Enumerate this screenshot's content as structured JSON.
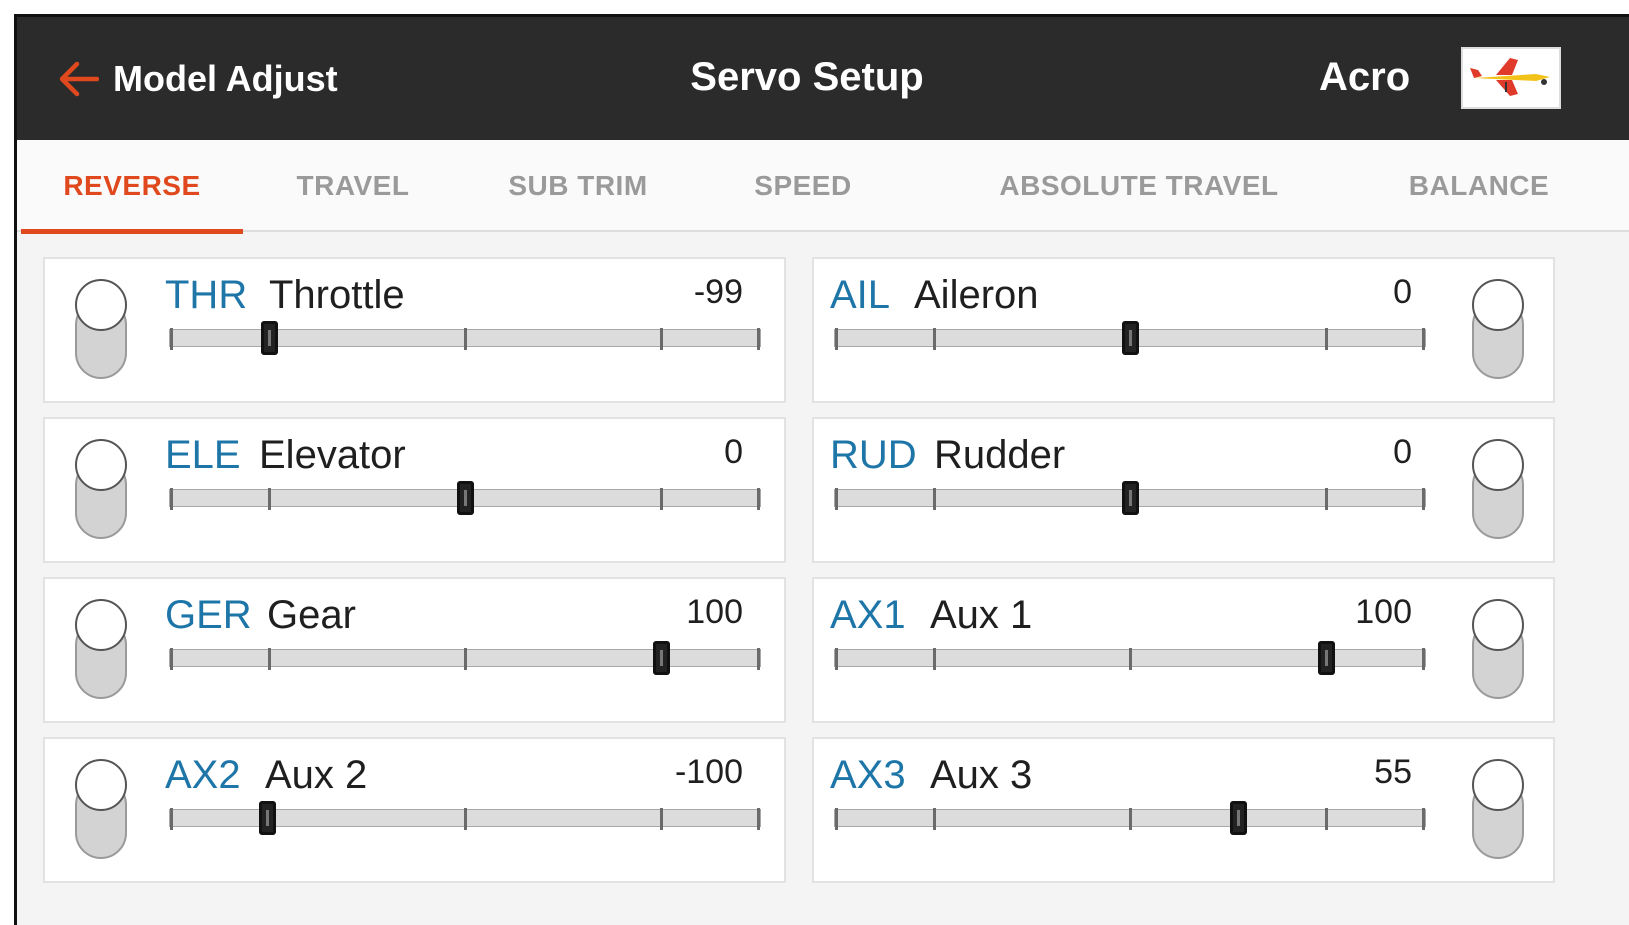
{
  "header": {
    "back_label": "Model Adjust",
    "title": "Servo Setup",
    "model_name": "Acro",
    "thumbnail_icon": "airplane-thumbnail-icon",
    "accent_color": "#e0491e"
  },
  "tabs": [
    {
      "label": "REVERSE",
      "active": true
    },
    {
      "label": "TRAVEL",
      "active": false
    },
    {
      "label": "SUB TRIM",
      "active": false
    },
    {
      "label": "SPEED",
      "active": false
    },
    {
      "label": "ABSOLUTE TRAVEL",
      "active": false
    },
    {
      "label": "BALANCE",
      "active": false
    }
  ],
  "channels": [
    {
      "abbr": "THR",
      "name": "Throttle",
      "value": "-99"
    },
    {
      "abbr": "AIL",
      "name": "Aileron",
      "value": "0"
    },
    {
      "abbr": "ELE",
      "name": "Elevator",
      "value": "0"
    },
    {
      "abbr": "RUD",
      "name": "Rudder",
      "value": "0"
    },
    {
      "abbr": "GER",
      "name": "Gear",
      "value": "100"
    },
    {
      "abbr": "AX1",
      "name": "Aux 1",
      "value": "100"
    },
    {
      "abbr": "AX2",
      "name": "Aux 2",
      "value": "-100"
    },
    {
      "abbr": "AX3",
      "name": "Aux 3",
      "value": "55"
    }
  ]
}
